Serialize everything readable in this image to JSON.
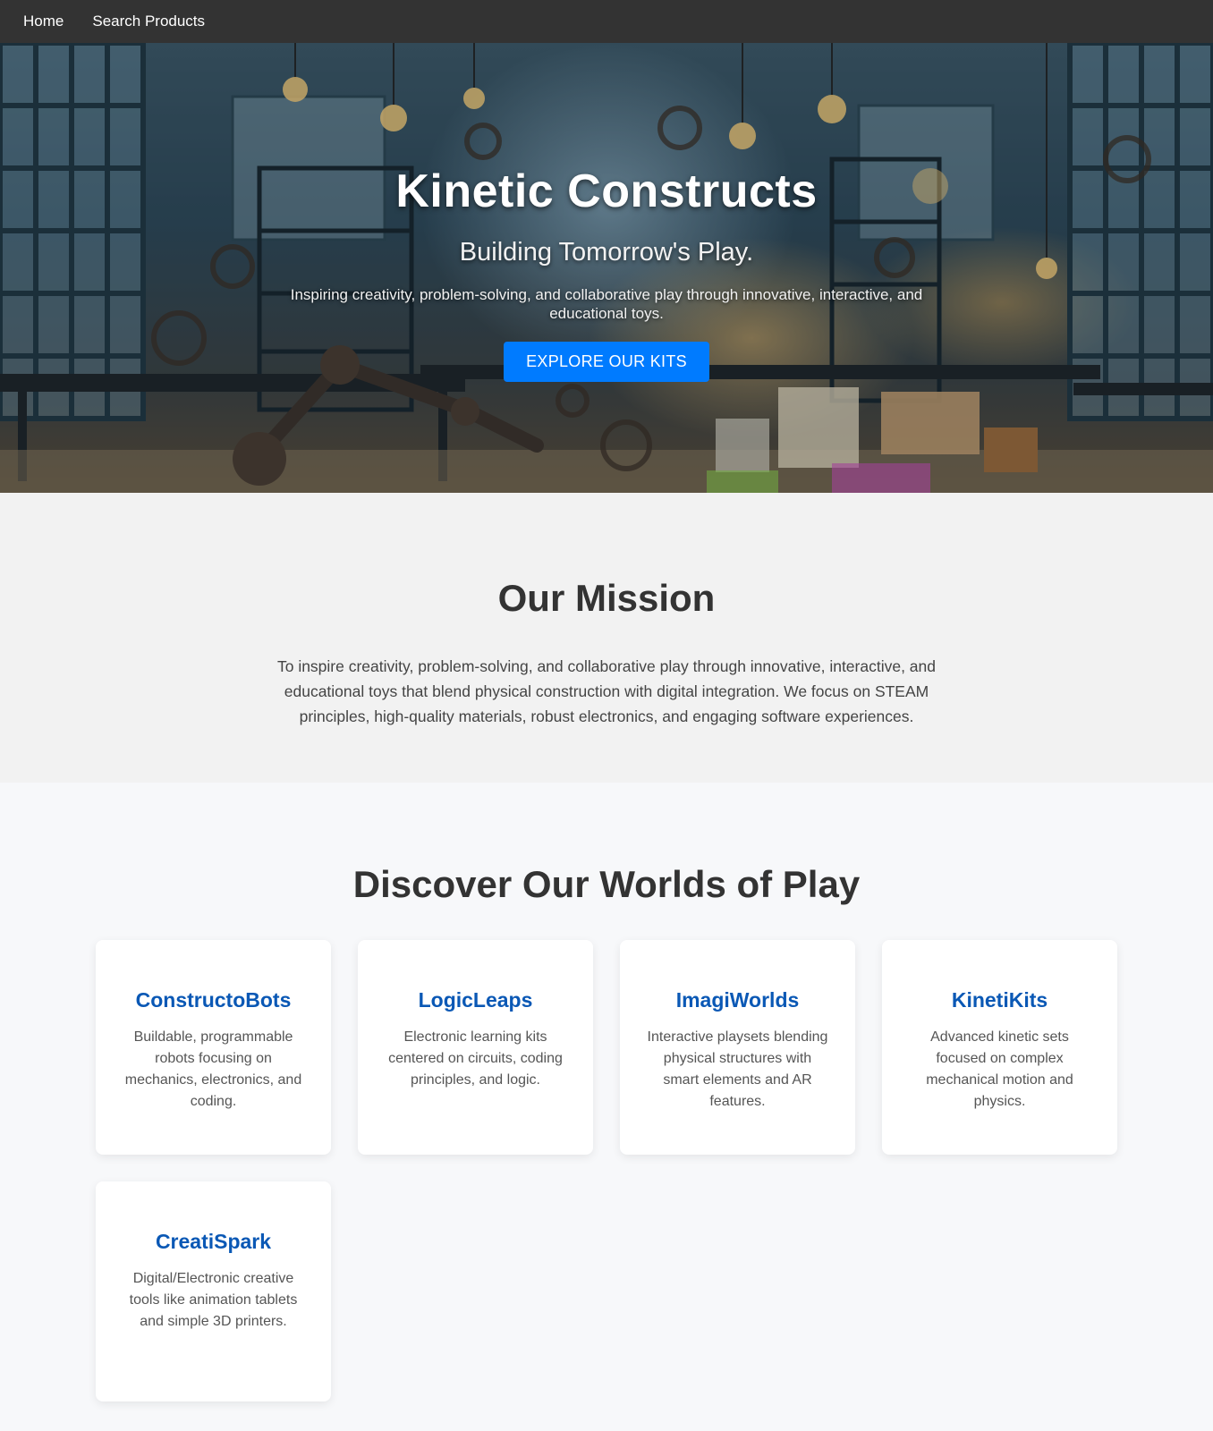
{
  "nav": {
    "items": [
      {
        "label": "Home"
      },
      {
        "label": "Search Products"
      }
    ]
  },
  "hero": {
    "title": "Kinetic Constructs",
    "tagline": "Building Tomorrow's Play.",
    "description": "Inspiring creativity, problem-solving, and collaborative play through innovative, interactive, and educational toys.",
    "cta_label": "EXPLORE OUR KITS"
  },
  "mission": {
    "title": "Our Mission",
    "text": "To inspire creativity, problem-solving, and collaborative play through innovative, interactive, and educational toys that blend physical construction with digital integration. We focus on STEAM principles, high-quality materials, robust electronics, and engaging software experiences."
  },
  "worlds": {
    "title": "Discover Our Worlds of Play",
    "cards": [
      {
        "title": "ConstructoBots",
        "description": "Buildable, programmable robots focusing on mechanics, electronics, and coding."
      },
      {
        "title": "LogicLeaps",
        "description": "Electronic learning kits centered on circuits, coding principles, and logic."
      },
      {
        "title": "ImagiWorlds",
        "description": "Interactive playsets blending physical structures with smart elements and AR features."
      },
      {
        "title": "KinetiKits",
        "description": "Advanced kinetic sets focused on complex mechanical motion and physics."
      },
      {
        "title": "CreatiSpark",
        "description": "Digital/Electronic creative tools like animation tablets and simple 3D printers."
      }
    ]
  },
  "colors": {
    "nav_bg": "#333333",
    "cta_blue": "#007bff",
    "card_title_blue": "#0a58b5",
    "mission_bg": "#f2f2f2",
    "page_bg": "#f7f8fa"
  }
}
